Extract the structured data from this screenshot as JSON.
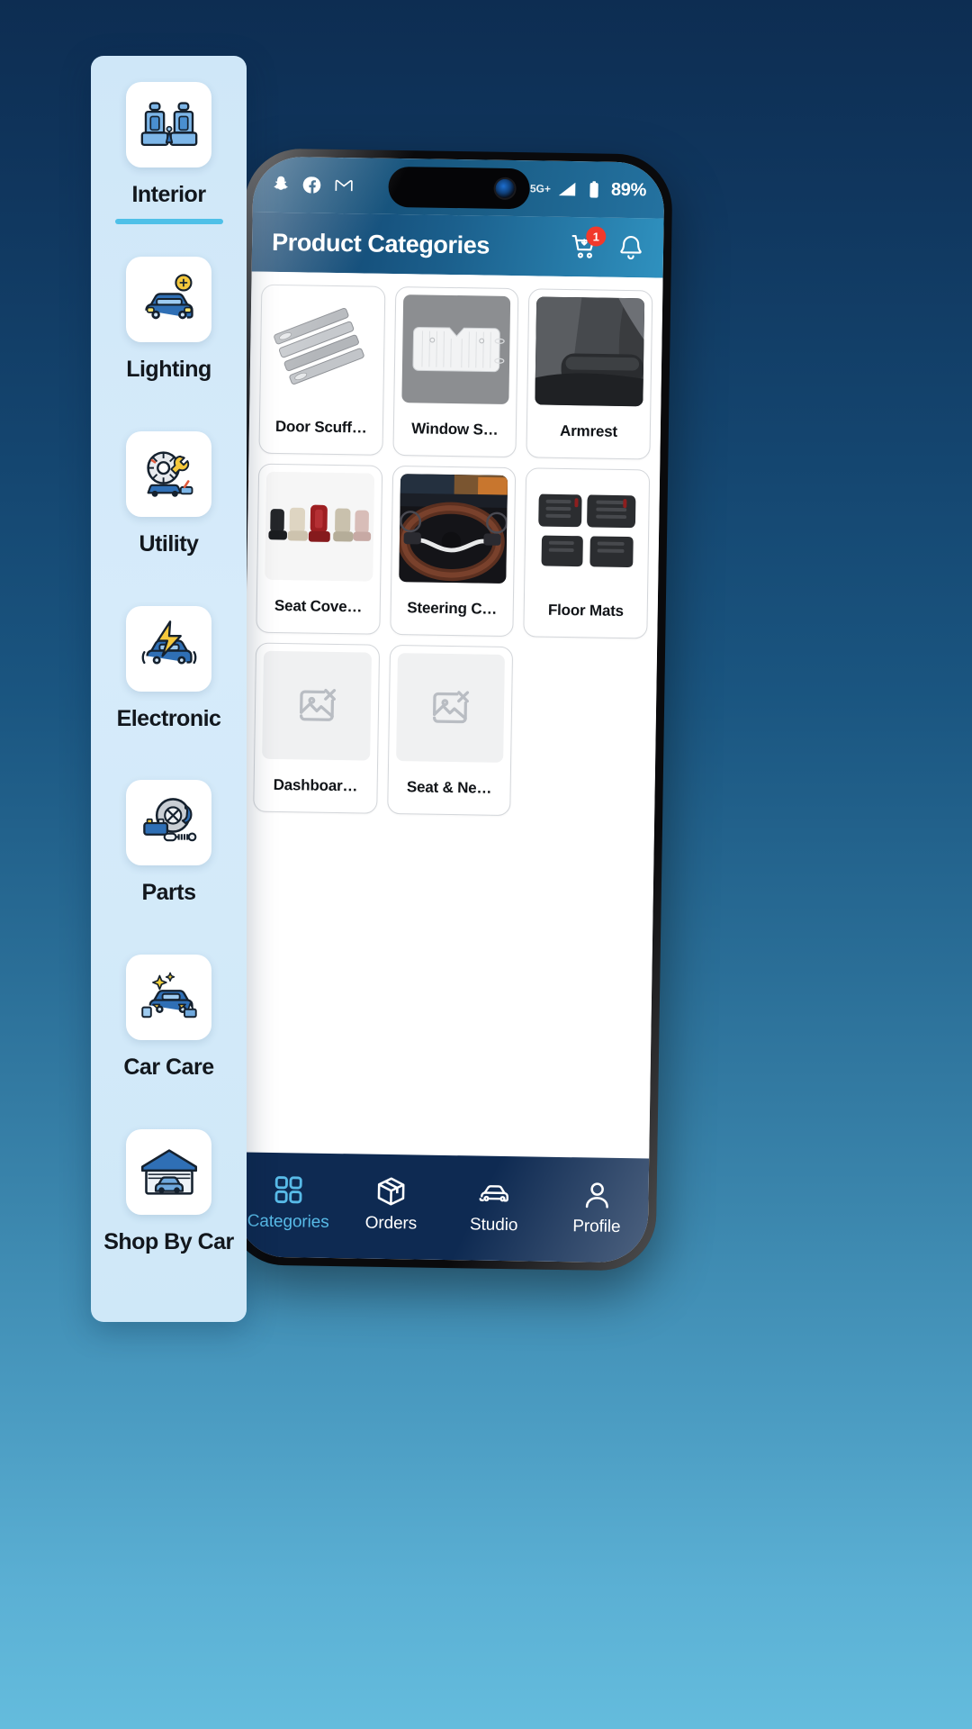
{
  "statusbar": {
    "left_icons": [
      "snapchat-icon",
      "facebook-icon",
      "gmail-icon"
    ],
    "right_icons": [
      "alarm-icon",
      "missed-call-icon",
      "data-saver-icon",
      "signal-icon"
    ],
    "network": "5G+",
    "battery": "89%"
  },
  "header": {
    "title": "Product Categories",
    "cart_badge": "1",
    "cart_icon": "cart-icon",
    "bell_icon": "bell-icon"
  },
  "products": [
    {
      "label": "Door Scuff…",
      "image": "door-scuff-plates",
      "kind": "photo"
    },
    {
      "label": "Window S…",
      "image": "window-sunshade",
      "kind": "photo"
    },
    {
      "label": "Armrest",
      "image": "car-armrest",
      "kind": "photo"
    },
    {
      "label": "Seat Cove…",
      "image": "seat-covers",
      "kind": "photo"
    },
    {
      "label": "Steering C…",
      "image": "steering-cover",
      "kind": "photo"
    },
    {
      "label": "Floor Mats",
      "image": "floor-mats",
      "kind": "photo"
    },
    {
      "label": "Dashboar…",
      "image": "broken-image",
      "kind": "placeholder"
    },
    {
      "label": "Seat & Ne…",
      "image": "broken-image",
      "kind": "placeholder"
    }
  ],
  "bottom_nav": [
    {
      "label": "Categories",
      "icon": "grid-icon",
      "active": true
    },
    {
      "label": "Orders",
      "icon": "box-icon",
      "active": false
    },
    {
      "label": "Studio",
      "icon": "car-icon",
      "active": false
    },
    {
      "label": "Profile",
      "icon": "person-icon",
      "active": false
    }
  ],
  "rail": {
    "items": [
      {
        "label": "Interior",
        "icon": "car-seats-icon",
        "selected": true
      },
      {
        "label": "Lighting",
        "icon": "car-light-icon",
        "selected": false
      },
      {
        "label": "Utility",
        "icon": "car-tools-icon",
        "selected": false
      },
      {
        "label": "Electronic",
        "icon": "car-battery-icon",
        "selected": false
      },
      {
        "label": "Parts",
        "icon": "car-parts-icon",
        "selected": false
      },
      {
        "label": "Car Care",
        "icon": "car-wash-icon",
        "selected": false
      },
      {
        "label": "Shop By Car",
        "icon": "car-garage-icon",
        "selected": false
      }
    ]
  },
  "colors": {
    "accent": "#4fc0e8",
    "nav_bg": "#0e2a52",
    "header_start": "#0f3e68",
    "header_end": "#2f91bf",
    "badge": "#f1392b",
    "rail_bg": "#d3e9f9"
  }
}
